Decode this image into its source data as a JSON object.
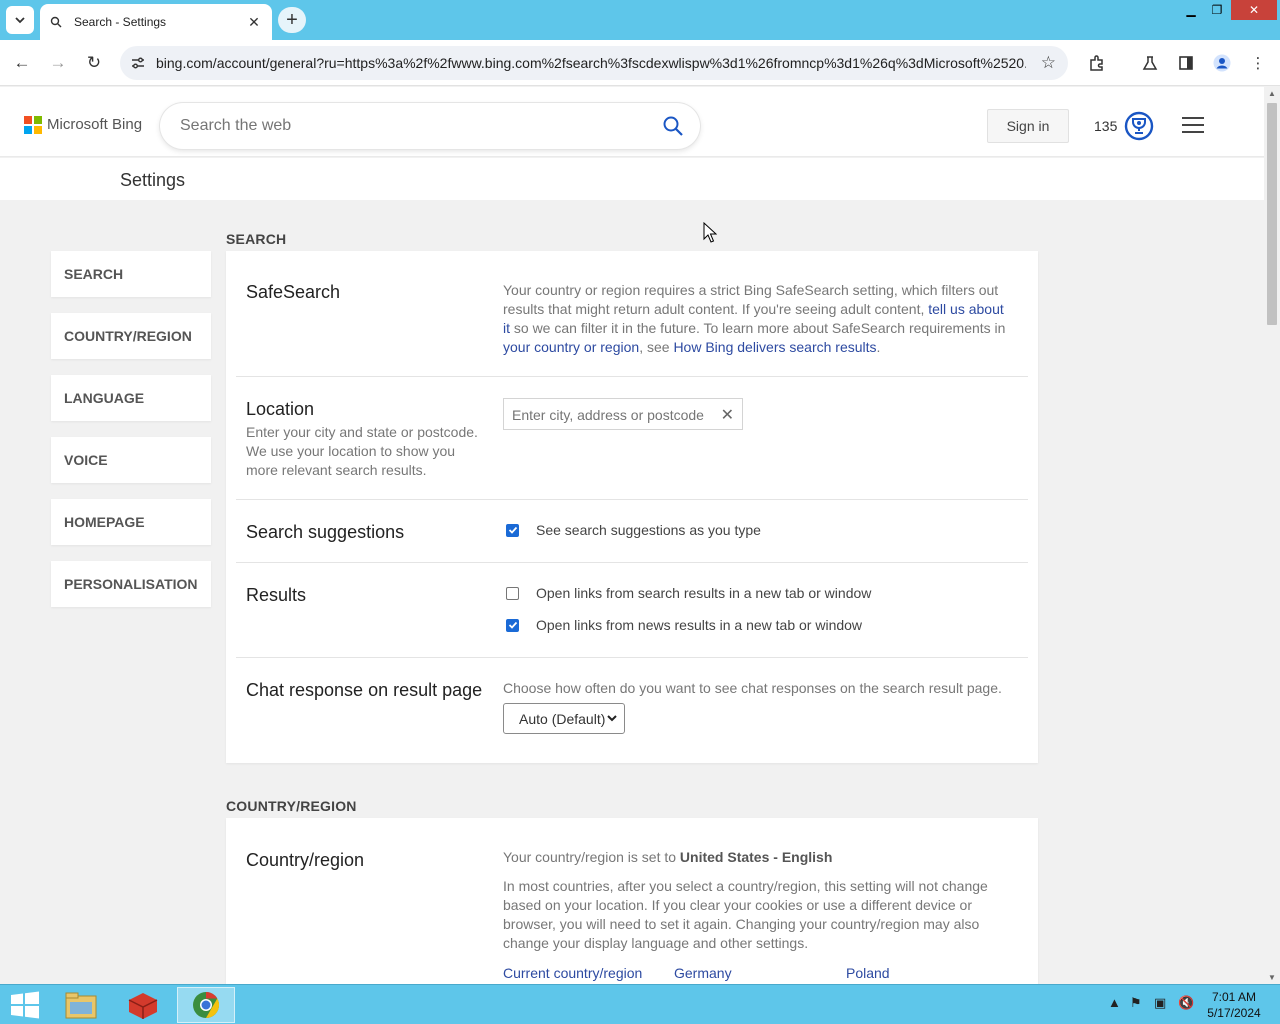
{
  "browser": {
    "tab_title": "Search - Settings",
    "url": "bing.com/account/general?ru=https%3a%2f%2fwww.bing.com%2fsearch%3fscdexwlispw%3d1%26fromncp%3d1%26q%3dMicrosoft%2520..."
  },
  "header": {
    "brand": "Microsoft Bing",
    "search_placeholder": "Search the web",
    "signin_label": "Sign in",
    "points": "135"
  },
  "settings": {
    "title": "Settings"
  },
  "sidebar": {
    "items": [
      {
        "label": "SEARCH"
      },
      {
        "label": "COUNTRY/REGION"
      },
      {
        "label": "LANGUAGE"
      },
      {
        "label": "VOICE"
      },
      {
        "label": "HOMEPAGE"
      },
      {
        "label": "PERSONALISATION"
      }
    ]
  },
  "search_section": {
    "label": "SEARCH",
    "safesearch": {
      "title": "SafeSearch",
      "text1": "Your country or region requires a strict Bing SafeSearch setting, which filters out results that might return adult content. If you're seeing adult content, ",
      "link1": "tell us about it",
      "text2": " so we can filter it in the future. To learn more about SafeSearch requirements in ",
      "link2": "your country or region",
      "text3": ", see ",
      "link3": "How Bing delivers search results",
      "text4": "."
    },
    "location": {
      "title": "Location",
      "desc": "Enter your city and state or postcode. We use your location to show you more relevant search results.",
      "placeholder": "Enter city, address or postcode"
    },
    "suggestions": {
      "title": "Search suggestions",
      "option": "See search suggestions as you type",
      "checked": true
    },
    "results": {
      "title": "Results",
      "option1": "Open links from search results in a new tab or window",
      "option1_checked": false,
      "option2": "Open links from news results in a new tab or window",
      "option2_checked": true
    },
    "chat": {
      "title": "Chat response on result page",
      "desc": "Choose how often do you want to see chat responses on the search result page.",
      "selected": "Auto (Default)"
    }
  },
  "country_section": {
    "label": "COUNTRY/REGION",
    "title": "Country/region",
    "current_prefix": "Your country/region is set to ",
    "current_value": "United States - English",
    "desc": "In most countries, after you select a country/region, this setting will not change based on your location. If you clear your cookies or use a different device or browser, you will need to set it again. Changing your country/region may also change your display language and other settings.",
    "links": [
      "Current country/region",
      "Germany",
      "Poland"
    ]
  },
  "taskbar": {
    "time": "7:01 AM",
    "date": "5/17/2024"
  },
  "colors": {
    "accent": "#5ec6ea",
    "link": "#2d4aa1",
    "checkbox": "#1a6ad6"
  }
}
